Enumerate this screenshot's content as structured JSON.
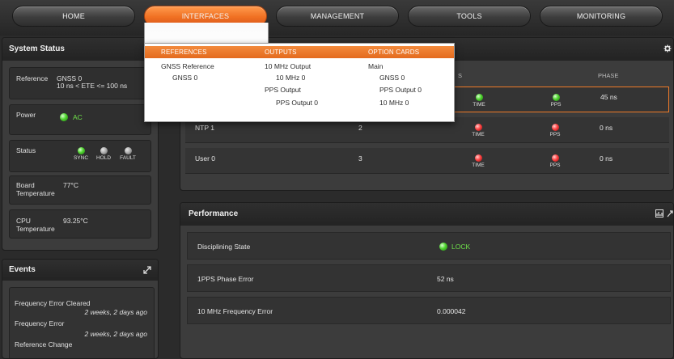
{
  "nav": {
    "items": [
      {
        "label": "HOME"
      },
      {
        "label": "INTERFACES"
      },
      {
        "label": "MANAGEMENT"
      },
      {
        "label": "TOOLS"
      },
      {
        "label": "MONITORING"
      }
    ],
    "active": "INTERFACES"
  },
  "dropdown": {
    "headers": {
      "references": "REFERENCES",
      "outputs": "OUTPUTS",
      "option_cards": "OPTION CARDS"
    },
    "references": [
      "GNSS Reference",
      "GNSS 0"
    ],
    "outputs": [
      "10 MHz Output",
      "10 MHz 0",
      "PPS Output",
      "PPS Output 0"
    ],
    "option_cards": [
      "Main",
      "GNSS 0",
      "PPS Output 0",
      "10 MHz 0"
    ]
  },
  "system_status": {
    "title": "System Status",
    "reference_label": "Reference",
    "reference_value": "GNSS 0",
    "reference_detail": "10 ns < ETE <= 100 ns",
    "power_label": "Power",
    "power_value": "AC",
    "status_label": "Status",
    "status_sync": "SYNC",
    "status_hold": "HOLD",
    "status_fault": "FAULT",
    "board_temp_label_1": "Board",
    "board_temp_label_2": "Temperature",
    "board_temp_value": "77°C",
    "cpu_temp_label_1": "CPU",
    "cpu_temp_label_2": "Temperature",
    "cpu_temp_value": "93.25°C"
  },
  "events": {
    "title": "Events",
    "items": [
      {
        "name": "Frequency Error Cleared",
        "time": "2 weeks, 2 days ago"
      },
      {
        "name": "Frequency Error",
        "time": "2 weeks, 2 days ago"
      },
      {
        "name": "Reference Change",
        "time": ""
      }
    ]
  },
  "references_table": {
    "phase_header": "PHASE",
    "partial_header": "S",
    "rows": [
      {
        "name": "",
        "priority": "",
        "time_label": "TIME",
        "pps_label": "PPS",
        "phase": "45 ns",
        "time_status": "green",
        "pps_status": "green"
      },
      {
        "name": "NTP 1",
        "priority": "2",
        "time_label": "TIME",
        "pps_label": "PPS",
        "phase": "0 ns",
        "time_status": "red",
        "pps_status": "red"
      },
      {
        "name": "User 0",
        "priority": "3",
        "time_label": "TIME",
        "pps_label": "PPS",
        "phase": "0 ns",
        "time_status": "red",
        "pps_status": "red"
      }
    ]
  },
  "performance": {
    "title": "Performance",
    "rows": [
      {
        "label": "Disciplining State",
        "value": "LOCK"
      },
      {
        "label": "1PPS Phase Error",
        "value": "52 ns"
      },
      {
        "label": "10 MHz Frequency Error",
        "value": "0.000042"
      }
    ]
  },
  "colors": {
    "accent": "#f07022",
    "lock_green": "#4fd32e",
    "fault_red": "#ff4242"
  },
  "icons": {
    "settings": "gear-icon",
    "expand": "expand-icon",
    "chart": "chart-icon"
  }
}
